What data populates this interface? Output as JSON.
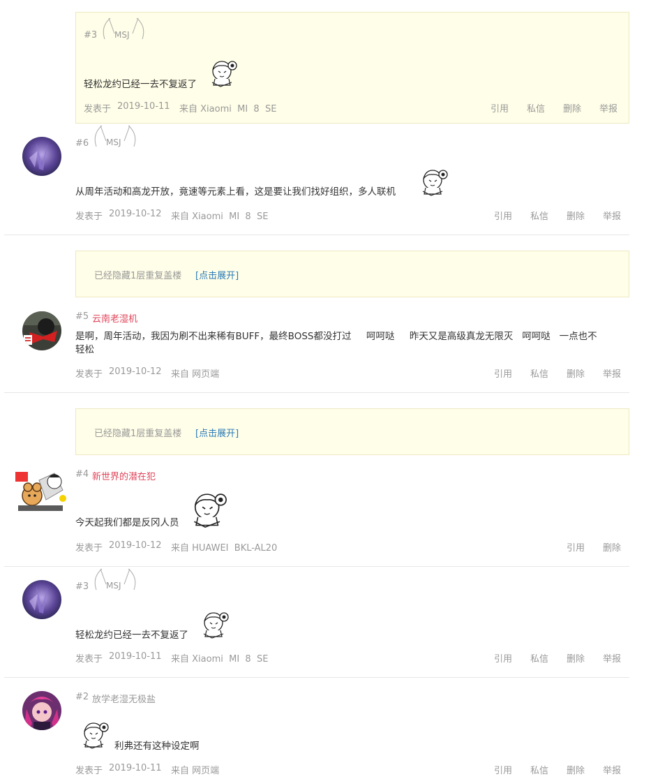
{
  "quoted_post": {
    "floor": "#3",
    "username": "MSJ",
    "content": "轻松龙约已经一去不复返了",
    "posted_prefix": "发表于",
    "date": "2019-10-11",
    "source": "来自 Xiaomi  MI  8  SE",
    "actions": [
      "引用",
      "私信",
      "删除",
      "举报"
    ]
  },
  "posts": [
    {
      "floor": "#6",
      "username": "MSJ",
      "content": "从周年活动和高龙开放，竟速等元素上看，这是要让我们找好组织，多人联机",
      "posted_prefix": "发表于",
      "date": "2019-10-12",
      "source": "来自 Xiaomi  MI  8  SE",
      "actions": [
        "引用",
        "私信",
        "删除",
        "举报"
      ]
    },
    {
      "floor": "#5",
      "username": "云南老湿机",
      "content_line1": "是啊，周年活动，我因为刷不出来稀有BUFF，最终BOSS都没打过     呵呵哒     昨天又是高级真龙无限灭   呵呵哒   一点也不",
      "content_line2": "轻松",
      "posted_prefix": "发表于",
      "date": "2019-10-12",
      "source": "来自 网页端",
      "actions": [
        "引用",
        "私信",
        "删除",
        "举报"
      ]
    },
    {
      "floor": "#4",
      "username": "新世界的潜在犯",
      "content": "今天起我们都是反冈人员",
      "posted_prefix": "发表于",
      "date": "2019-10-12",
      "source": "来自 HUAWEI  BKL-AL20",
      "actions": [
        "引用",
        "删除"
      ]
    },
    {
      "floor": "#3",
      "username": "MSJ",
      "content": "轻松龙约已经一去不复返了",
      "posted_prefix": "发表于",
      "date": "2019-10-11",
      "source": "来自 Xiaomi  MI  8  SE",
      "actions": [
        "引用",
        "私信",
        "删除",
        "举报"
      ]
    },
    {
      "floor": "#2",
      "username": "放学老湿无极盐",
      "content": "利弗还有这种设定啊",
      "posted_prefix": "发表于",
      "date": "2019-10-11",
      "source": "来自 网页端",
      "actions": [
        "引用",
        "私信",
        "删除",
        "举报"
      ]
    }
  ],
  "hidden_notices": [
    {
      "text": "已经隐藏1层重复盖楼",
      "link": "[点击展开]"
    },
    {
      "text": "已经隐藏1层重复盖楼",
      "link": "[点击展开]"
    }
  ],
  "colors": {
    "highlight_bg": "#fffee8",
    "username_red": "#e0455a",
    "link_blue": "#2a7ab8",
    "meta_grey": "#999999"
  }
}
